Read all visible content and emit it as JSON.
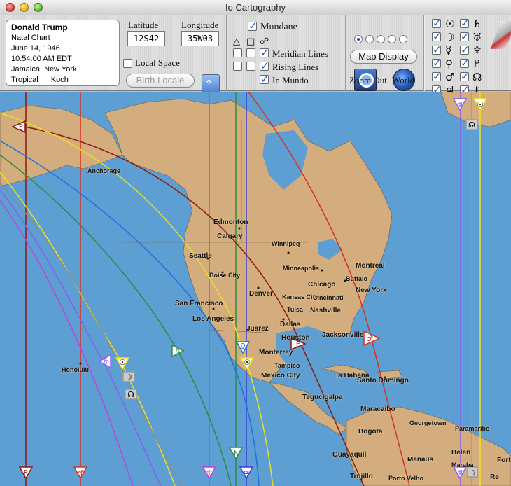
{
  "window": {
    "title": "Io Cartography"
  },
  "chart_info": {
    "name": "Donald Trump",
    "type": "Natal Chart",
    "date": "June 14, 1946",
    "time": "10:54:00 AM EDT",
    "place": "Jamaica, New York",
    "zodiac": "Tropical",
    "house_system": "Koch"
  },
  "locale": {
    "latitude_label": "Latitude",
    "latitude_value": "12S42",
    "longitude_label": "Longitude",
    "longitude_value": "35W03",
    "local_space_label": "Local Space",
    "local_space_checked": false,
    "birth_locale_label": "Birth Locale"
  },
  "mundane": {
    "mundane_label": "Mundane",
    "mundane_checked": true,
    "meridian_label": "Meridian Lines",
    "rising_label": "Rising Lines",
    "inmundo_label": "In Mundo"
  },
  "display": {
    "map_display_label": "Map Display",
    "zoom_out_label": "Zoom Out",
    "world_label": "World",
    "radio_selected": 0
  },
  "planets_col1": [
    "☉",
    "☽",
    "☿",
    "♀",
    "♂",
    "♃"
  ],
  "planets_col2": [
    "♄",
    "♅",
    "♆",
    "♇",
    "☊",
    "⚷"
  ],
  "map": {
    "cities": [
      {
        "name": "Anchorage",
        "cls": "sm"
      },
      {
        "name": "Edmonton"
      },
      {
        "name": "Calgary"
      },
      {
        "name": "Winnipeg",
        "cls": "sm"
      },
      {
        "name": "Seattle"
      },
      {
        "name": "Boise City",
        "cls": "sm"
      },
      {
        "name": "Minneapolis",
        "cls": "sm"
      },
      {
        "name": "Montreal"
      },
      {
        "name": "Buffalo",
        "cls": "sm"
      },
      {
        "name": "Chicago"
      },
      {
        "name": "New York"
      },
      {
        "name": "Denver"
      },
      {
        "name": "Kansas City",
        "cls": "sm"
      },
      {
        "name": "Cincinnati",
        "cls": "sm"
      },
      {
        "name": "San Francisco"
      },
      {
        "name": "Tulsa",
        "cls": "sm"
      },
      {
        "name": "Nashville"
      },
      {
        "name": "Los Angeles"
      },
      {
        "name": "Juarez"
      },
      {
        "name": "Dallas"
      },
      {
        "name": "Jacksonville"
      },
      {
        "name": "Houston"
      },
      {
        "name": "Monterrey"
      },
      {
        "name": "Honolulu",
        "cls": "sm"
      },
      {
        "name": "Tampico",
        "cls": "sm"
      },
      {
        "name": "La Habana"
      },
      {
        "name": "Mexico City"
      },
      {
        "name": "Santo Domingo"
      },
      {
        "name": "Tegucigalpa"
      },
      {
        "name": "Maracaibo"
      },
      {
        "name": "Georgetown",
        "cls": "sm"
      },
      {
        "name": "Paramaribo",
        "cls": "sm"
      },
      {
        "name": "Bogota"
      },
      {
        "name": "Guayaquil"
      },
      {
        "name": "Manaus"
      },
      {
        "name": "Belen"
      },
      {
        "name": "Fortalez"
      },
      {
        "name": "Maraba",
        "cls": "sm"
      },
      {
        "name": "Trujillo"
      },
      {
        "name": "Porto Velho",
        "cls": "sm"
      },
      {
        "name": "Re"
      }
    ]
  },
  "colors": {
    "sun": "#f0e020",
    "moon": "#8c8c8c",
    "mercury": "#2e8b3c",
    "venus": "#1e6fe0",
    "mars": "#d63020",
    "jupiter": "#3a3fd8",
    "saturn": "#2e8b3c",
    "uranus": "#8a5cf0",
    "neptune": "#c040e0",
    "pluto": "#8a1a10",
    "node": "#999999",
    "ocean": "#5d9ed3",
    "land": "#d3ad7d"
  }
}
